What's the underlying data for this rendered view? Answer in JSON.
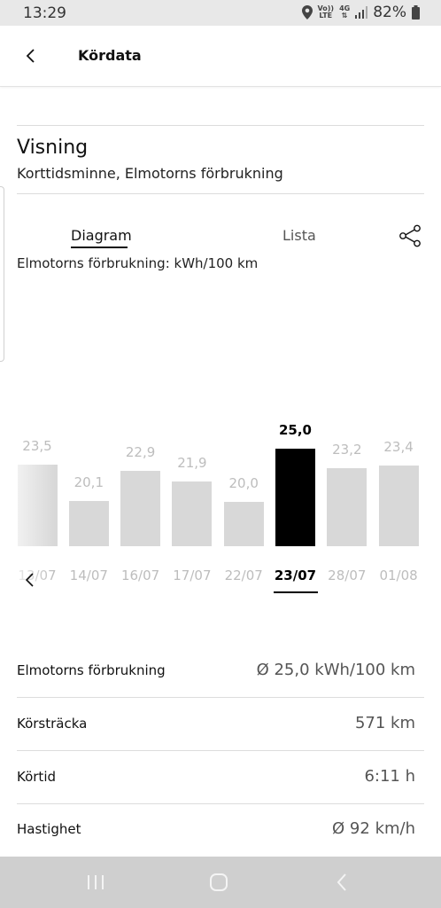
{
  "status_bar": {
    "time": "13:29",
    "net_top": "Vo))",
    "net_bottom": "LTE",
    "net2_top": "4G",
    "battery": "82%"
  },
  "header": {
    "title": "Kördata"
  },
  "view": {
    "title": "Visning",
    "subtitle": "Korttidsminne, Elmotorns förbrukning"
  },
  "tabs": {
    "diagram": "Diagram",
    "list": "Lista"
  },
  "chart_data": {
    "type": "bar",
    "label": "Elmotorns förbrukning: kWh/100 km",
    "categories": [
      "13/07",
      "14/07",
      "16/07",
      "17/07",
      "22/07",
      "23/07",
      "28/07",
      "01/08"
    ],
    "values": [
      23.5,
      20.1,
      22.9,
      21.9,
      20.0,
      25.0,
      23.2,
      23.4
    ],
    "value_labels": [
      "23,5",
      "20,1",
      "22,9",
      "21,9",
      "20,0",
      "25,0",
      "23,2",
      "23,4"
    ],
    "selected_index": 5,
    "colors": {
      "bar": "#d8d8d8",
      "selected": "#000000"
    }
  },
  "details": [
    {
      "label": "Elmotorns förbrukning",
      "value": "Ø 25,0 kWh/100 km"
    },
    {
      "label": "Körsträcka",
      "value": "571 km"
    },
    {
      "label": "Körtid",
      "value": "6:11 h"
    },
    {
      "label": "Hastighet",
      "value": "Ø 92 km/h"
    }
  ]
}
